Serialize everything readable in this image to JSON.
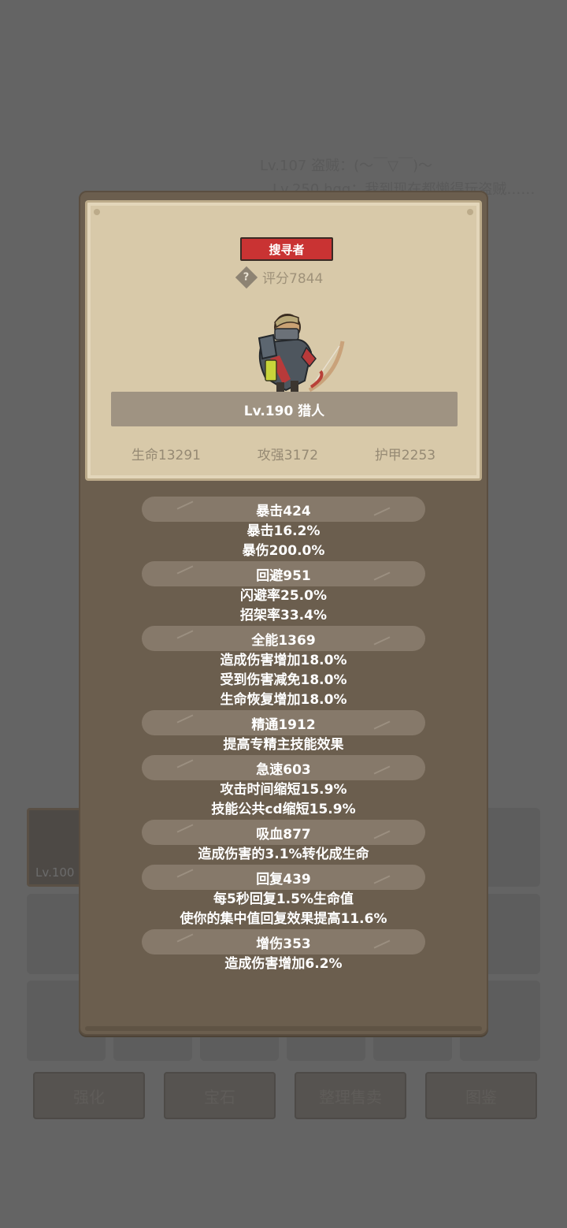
{
  "background": {
    "chat": [
      "Lv.107 盗贼：(～￣▽￣)～",
      "Lv.250 hqq：我到现在都懒得玩盗贼……"
    ],
    "equipped_item_level": "Lv.100",
    "buttons": [
      "强化",
      "宝石",
      "整理售卖",
      "图鉴"
    ]
  },
  "card": {
    "title_badge": "搜寻者",
    "score_label": "评分7844",
    "name": "Lv.190 猎人",
    "stats": [
      "生命13291",
      "攻强3172",
      "护甲2253"
    ]
  },
  "groups": [
    {
      "head": "暴击424",
      "lines": [
        "暴击16.2%",
        "暴伤200.0%"
      ]
    },
    {
      "head": "回避951",
      "lines": [
        "闪避率25.0%",
        "招架率33.4%"
      ]
    },
    {
      "head": "全能1369",
      "lines": [
        "造成伤害增加18.0%",
        "受到伤害减免18.0%",
        "生命恢复增加18.0%"
      ]
    },
    {
      "head": "精通1912",
      "lines": [
        "提高专精主技能效果"
      ]
    },
    {
      "head": "急速603",
      "lines": [
        "攻击时间缩短15.9%",
        "技能公共cd缩短15.9%"
      ]
    },
    {
      "head": "吸血877",
      "lines": [
        "造成伤害的3.1%转化成生命"
      ]
    },
    {
      "head": "回复439",
      "lines": [
        "每5秒回复1.5%生命值",
        "使你的集中值回复效果提高11.6%"
      ]
    },
    {
      "head": "增伤353",
      "lines": [
        "造成伤害增加6.2%"
      ]
    }
  ],
  "icons": {
    "help": "help-icon",
    "hero": "hunter-portrait"
  }
}
